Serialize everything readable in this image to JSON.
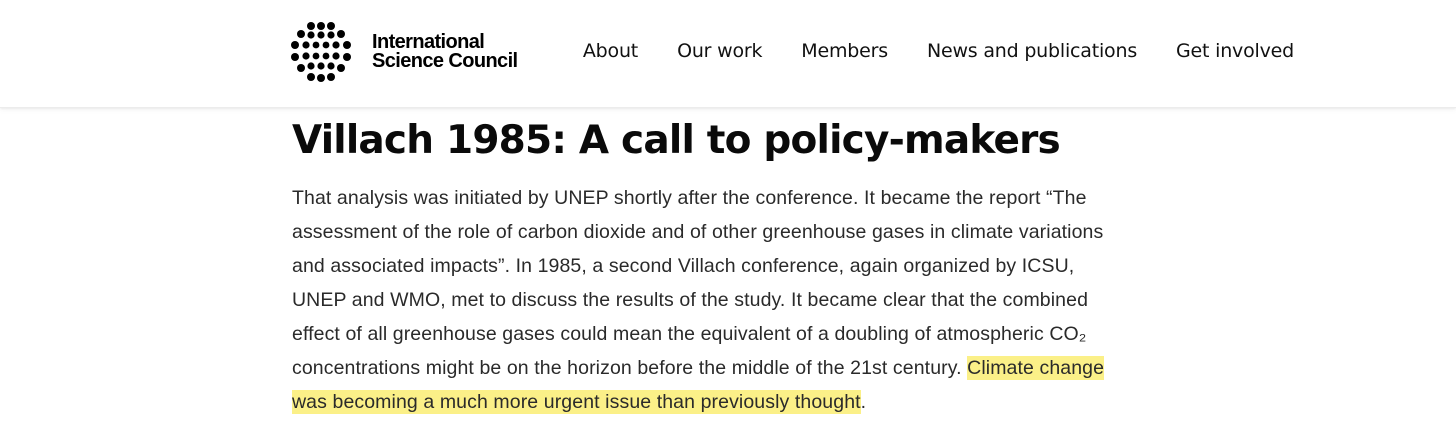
{
  "header": {
    "logo": {
      "line1": "International",
      "line2": "Science Council"
    },
    "nav": {
      "about": "About",
      "our_work": "Our work",
      "members": "Members",
      "news": "News and publications",
      "get_involved": "Get involved"
    }
  },
  "article": {
    "title": "Villach 1985: A call to policy-makers",
    "paragraph": {
      "text_before": "That analysis was initiated by UNEP shortly after the conference. It became the report “The assessment of the role of carbon dioxide and of other greenhouse gases in climate variations and associated impacts”. In 1985, a second Villach conference, again organized by ICSU, UNEP and WMO, met to discuss the results of the study. It became clear that the combined effect of all greenhouse gases could mean the equivalent of a doubling of atmospheric CO₂ concentrations might be on the horizon before the middle of the 21st century. ",
      "highlighted": "Climate change was becoming a much more urgent issue than previously thought",
      "text_after": "."
    }
  },
  "colors": {
    "highlight": "#fbf088",
    "text": "#2a2a2a",
    "heading": "#0a0a0a"
  }
}
